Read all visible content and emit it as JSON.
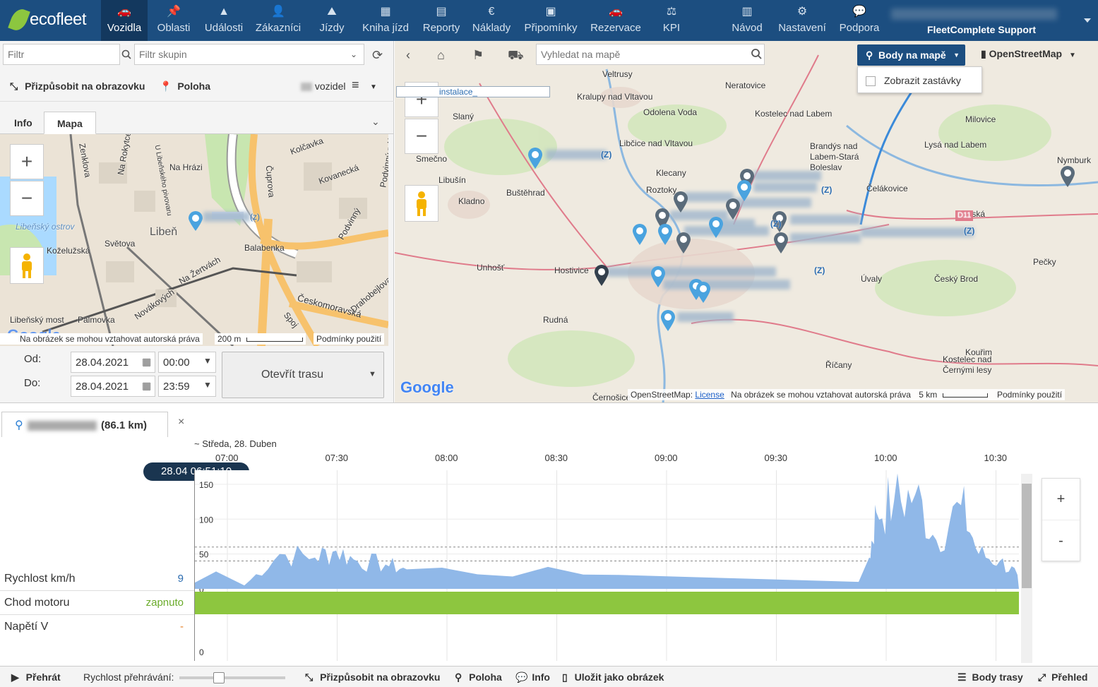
{
  "app": {
    "logo": "ecofleet"
  },
  "nav": [
    {
      "label": "Vozidla",
      "icon": "car-icon",
      "active": true
    },
    {
      "label": "Oblasti",
      "icon": "pin-icon"
    },
    {
      "label": "Události",
      "icon": "warning-icon"
    },
    {
      "label": "Zákazníci",
      "icon": "person-icon"
    },
    {
      "label": "Jízdy",
      "icon": "road-icon"
    },
    {
      "label": "Kniha jízd",
      "icon": "calendar-icon"
    },
    {
      "label": "Reporty",
      "icon": "document-icon"
    },
    {
      "label": "Náklady",
      "icon": "euro-icon"
    },
    {
      "label": "Připomínky",
      "icon": "calendar-check-icon"
    },
    {
      "label": "Rezervace",
      "icon": "car-icon"
    },
    {
      "label": "KPI",
      "icon": "scale-icon"
    },
    {
      "label": "Návod",
      "icon": "book-icon"
    },
    {
      "label": "Nastavení",
      "icon": "gears-icon"
    },
    {
      "label": "Podpora",
      "icon": "chat-icon"
    }
  ],
  "user": {
    "support": "FleetComplete Support"
  },
  "left": {
    "filter_placeholder": "Filtr",
    "group_placeholder": "Filtr skupin",
    "fit_label": "Přizpůsobit na obrazovku",
    "position_label": "Poloha",
    "vehicles_label": "vozidel",
    "tab_info": "Info",
    "tab_map": "Mapa",
    "map_places": [
      "Zenklova",
      "Na Rokytce",
      "Libeňský ostrov",
      "Světova",
      "Libeň",
      "Koželužská",
      "Čuprova",
      "Kovanecká",
      "Kolčavka",
      "Balabenka",
      "Na Žertvách",
      "Palmovka",
      "Českomoravská",
      "Drahobejlova",
      "Libeňský most",
      "Novákových",
      "Podvinný mlýn",
      "Spoj",
      "Na Hrázi",
      "Podvinný",
      "U Libeňského pivovaru"
    ],
    "attribution": "Na obrázek se mohou vztahovat autorská práva",
    "scale": "200 m",
    "terms": "Podmínky použití",
    "from_label": "Od:",
    "to_label": "Do:",
    "from_date": "28.04.2021",
    "from_time": "00:00",
    "to_date": "28.04.2021",
    "to_time": "23:59",
    "open_route": "Otevřít trasu",
    "pin_label": "(z)"
  },
  "map": {
    "search_placeholder": "Vyhledat na mapě",
    "points_button": "Body na mapě",
    "provider": "OpenStreetMap",
    "show_stops": "Zobrazit zastávky",
    "places": [
      {
        "name": "Veltrusy"
      },
      {
        "name": "Neratovice"
      },
      {
        "name": "Kralupy nad Vltavou"
      },
      {
        "name": "Odolena Voda"
      },
      {
        "name": "Kostelec nad Labem"
      },
      {
        "name": "Milovice"
      },
      {
        "name": "Slaný"
      },
      {
        "name": "Libčice nad Vltavou"
      },
      {
        "name": "Brandýs nad Labem-Stará Boleslav"
      },
      {
        "name": "Lysá nad Labem"
      },
      {
        "name": "Smečno"
      },
      {
        "name": "Klecany"
      },
      {
        "name": "Libušín"
      },
      {
        "name": "Buštěhrad"
      },
      {
        "name": "Roztoky"
      },
      {
        "name": "Čelákovice"
      },
      {
        "name": "Kladno"
      },
      {
        "name": "Sadská"
      },
      {
        "name": "Unhošť"
      },
      {
        "name": "Hostivice"
      },
      {
        "name": "Úvaly"
      },
      {
        "name": "Český Brod"
      },
      {
        "name": "Pečky"
      },
      {
        "name": "Rudná"
      },
      {
        "name": "Říčany"
      },
      {
        "name": "Kouřim"
      },
      {
        "name": "Kostelec nad Černými lesy"
      },
      {
        "name": "Nymburk"
      },
      {
        "name": "Černošice"
      },
      {
        "name": "D11"
      }
    ],
    "label_instalace": "instalace_",
    "attribution_osm": "OpenStreetMap:",
    "license": "License",
    "attribution": "Na obrázek se mohou vztahovat autorská práva",
    "scale": "5 km",
    "terms": "Podmínky použití",
    "pin_z": "(Z)"
  },
  "trip": {
    "distance": "(86.1 km)",
    "close": "×",
    "date_caption": "~ Středa, 28. Duben",
    "cursor_time": "28.04 06:51:10",
    "times": [
      "07:00",
      "07:30",
      "08:00",
      "08:30",
      "09:00",
      "09:30",
      "10:00",
      "10:30"
    ],
    "speed_label": "Rychlost km/h",
    "speed_value": "9",
    "engine_label": "Chod motoru",
    "engine_value": "zapnuto",
    "voltage_label": "Napětí V",
    "voltage_value": "-",
    "y_ticks": [
      "150",
      "100",
      "50",
      "0"
    ],
    "voltage_tick": "0",
    "zoom_in": "+",
    "zoom_out": "-",
    "colors": {
      "speed": "#90b8e8",
      "engine": "#8dc63f",
      "nav": "#1c4e80"
    }
  },
  "chart_data": {
    "type": "area",
    "ylabel": "Rychlost km/h",
    "ylim": [
      0,
      160
    ],
    "x": [
      "06:51",
      "06:55",
      "07:00",
      "07:10",
      "07:20",
      "07:30",
      "07:40",
      "07:50",
      "08:00",
      "09:00",
      "09:50",
      "09:55",
      "10:00",
      "10:05",
      "10:10",
      "10:15",
      "10:20",
      "10:25",
      "10:30",
      "10:35"
    ],
    "series": [
      {
        "values": [
          9,
          25,
          5,
          50,
          45,
          55,
          40,
          35,
          28,
          20,
          10,
          45,
          110,
          125,
          135,
          70,
          120,
          50,
          40,
          20
        ]
      }
    ]
  },
  "bottombar": {
    "play": "Přehrát",
    "speed_label": "Rychlost přehrávání:",
    "fit": "Přizpůsobit na obrazovku",
    "position": "Poloha",
    "info": "Info",
    "save": "Uložit jako obrázek",
    "route_points": "Body trasy",
    "overview": "Přehled"
  }
}
